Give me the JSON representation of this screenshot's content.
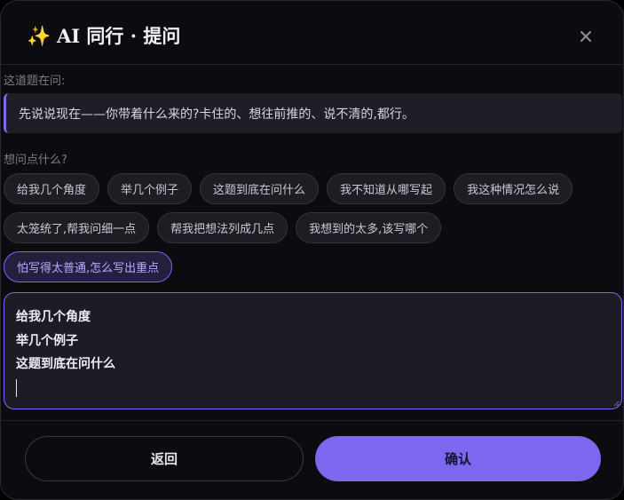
{
  "dialog": {
    "title": "AI 同行 · 提问",
    "title_icon": "sparkles-icon",
    "close_symbol": "×"
  },
  "question": {
    "label": "这道题在问:",
    "text": "先说说现在——你带着什么来的?卡住的、想往前推的、说不清的,都行。"
  },
  "suggestions": {
    "label": "想问点什么?",
    "rows": [
      [
        "给我几个角度",
        "举几个例子",
        "这题到底在问什么",
        "我不知道从哪写起",
        "我这种情况怎么说"
      ],
      [
        "太笼统了,帮我问细一点",
        "帮我把想法列成几点",
        "我想到的太多,该写哪个"
      ],
      [
        "怕写得太普通,怎么写出重点"
      ]
    ],
    "selected": [
      "怕写得太普通,怎么写出重点"
    ]
  },
  "input": {
    "lines": [
      "给我几个角度",
      "举几个例子",
      "这题到底在问什么"
    ]
  },
  "footer": {
    "back_label": "返回",
    "confirm_label": "确认"
  },
  "colors": {
    "accent": "#7b68ee",
    "background": "#0c0c10"
  }
}
